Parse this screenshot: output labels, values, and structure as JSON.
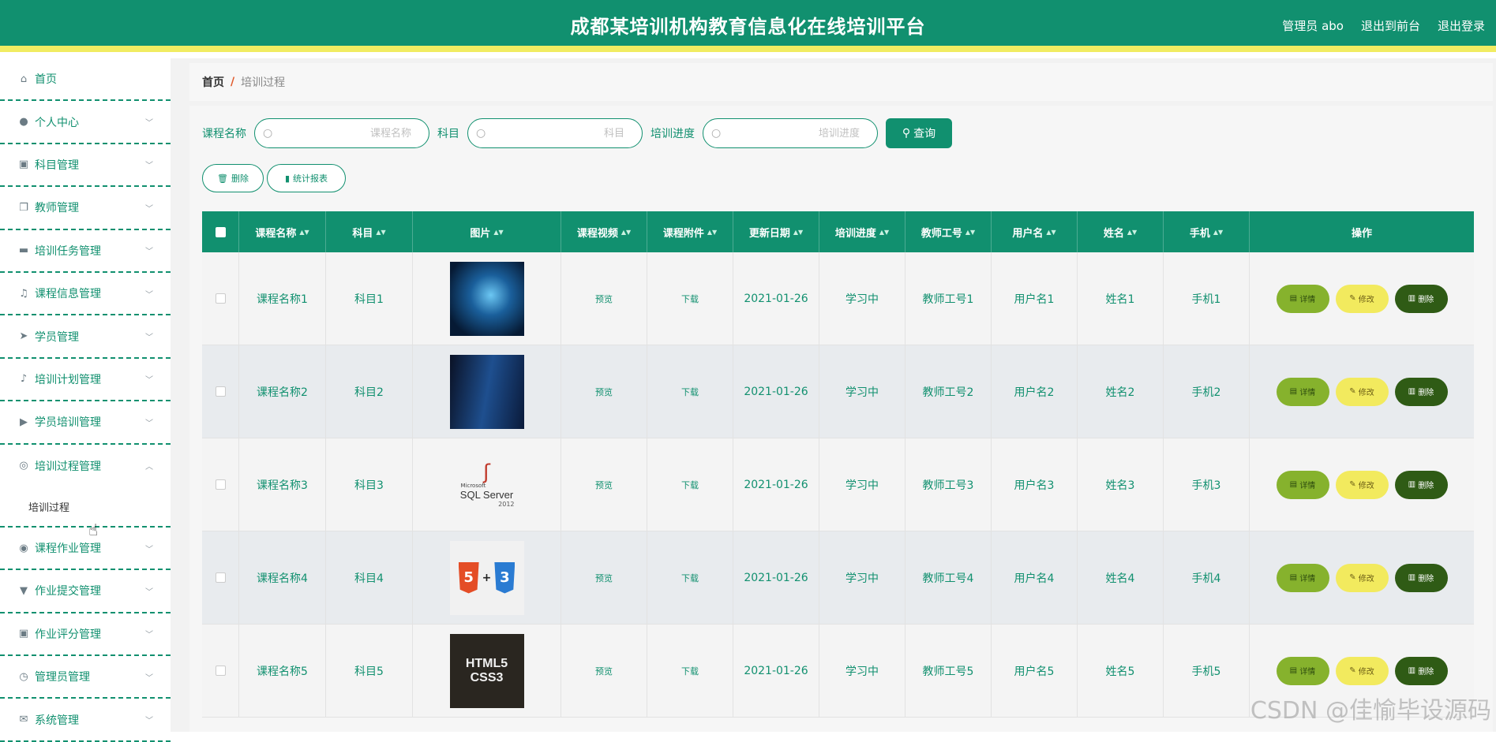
{
  "header": {
    "title": "成都某培训机构教育信息化在线培训平台",
    "user": "管理员 abo",
    "back_front": "退出到前台",
    "logout": "退出登录"
  },
  "sidebar": {
    "items": [
      {
        "label": "首页",
        "icon": "home-icon"
      },
      {
        "label": "个人中心",
        "icon": "user-icon"
      },
      {
        "label": "科目管理",
        "icon": "clipboard-icon"
      },
      {
        "label": "教师管理",
        "icon": "copy-icon"
      },
      {
        "label": "培训任务管理",
        "icon": "monitor-icon"
      },
      {
        "label": "课程信息管理",
        "icon": "bell-off-icon"
      },
      {
        "label": "学员管理",
        "icon": "send-icon"
      },
      {
        "label": "培训计划管理",
        "icon": "mic-icon"
      },
      {
        "label": "学员培训管理",
        "icon": "video-icon"
      },
      {
        "label": "培训过程管理",
        "icon": "target-icon"
      },
      {
        "label": "课程作业管理",
        "icon": "lifebuoy-icon"
      },
      {
        "label": "作业提交管理",
        "icon": "stamp-icon"
      },
      {
        "label": "作业评分管理",
        "icon": "clipboard-check-icon"
      },
      {
        "label": "管理员管理",
        "icon": "clock-icon"
      },
      {
        "label": "系统管理",
        "icon": "mail-icon"
      }
    ],
    "submenu_label": "培训过程"
  },
  "breadcrumb": {
    "home": "首页",
    "sep": "/",
    "current": "培训过程"
  },
  "search": {
    "course_label": "课程名称",
    "course_placeholder": "课程名称",
    "subject_label": "科目",
    "subject_placeholder": "科目",
    "progress_label": "培训进度",
    "progress_placeholder": "培训进度",
    "query_btn": "查询"
  },
  "actions": {
    "delete": "删除",
    "report": "统计报表"
  },
  "table": {
    "headers": [
      "课程名称",
      "科目",
      "图片",
      "课程视频",
      "课程附件",
      "更新日期",
      "培训进度",
      "教师工号",
      "用户名",
      "姓名",
      "手机",
      "操作"
    ],
    "rows": [
      {
        "course": "课程名称1",
        "subject": "科目1",
        "video": "预览",
        "attach": "下载",
        "date": "2021-01-26",
        "progress": "学习中",
        "teacher": "教师工号1",
        "username": "用户名1",
        "name": "姓名1",
        "phone": "手机1"
      },
      {
        "course": "课程名称2",
        "subject": "科目2",
        "video": "预览",
        "attach": "下载",
        "date": "2021-01-26",
        "progress": "学习中",
        "teacher": "教师工号2",
        "username": "用户名2",
        "name": "姓名2",
        "phone": "手机2"
      },
      {
        "course": "课程名称3",
        "subject": "科目3",
        "video": "预览",
        "attach": "下载",
        "date": "2021-01-26",
        "progress": "学习中",
        "teacher": "教师工号3",
        "username": "用户名3",
        "name": "姓名3",
        "phone": "手机3"
      },
      {
        "course": "课程名称4",
        "subject": "科目4",
        "video": "预览",
        "attach": "下载",
        "date": "2021-01-26",
        "progress": "学习中",
        "teacher": "教师工号4",
        "username": "用户名4",
        "name": "姓名4",
        "phone": "手机4"
      },
      {
        "course": "课程名称5",
        "subject": "科目5",
        "video": "预览",
        "attach": "下载",
        "date": "2021-01-26",
        "progress": "学习中",
        "teacher": "教师工号5",
        "username": "用户名5",
        "name": "姓名5",
        "phone": "手机5"
      }
    ],
    "op_detail": "详情",
    "op_edit": "修改",
    "op_delete": "删除"
  },
  "thumbs": {
    "sql_small": "Microsoft",
    "sql_text": "SQL Server",
    "sql_ver": "2012",
    "html5": "HTML5",
    "css3": "CSS3"
  },
  "colors": {
    "primary": "#11906f",
    "accent": "#f1ec62",
    "detail": "#86b22d",
    "edit": "#f2ea5e",
    "delete": "#2f5b15"
  },
  "watermark": "CSDN @佳愉毕设源码"
}
